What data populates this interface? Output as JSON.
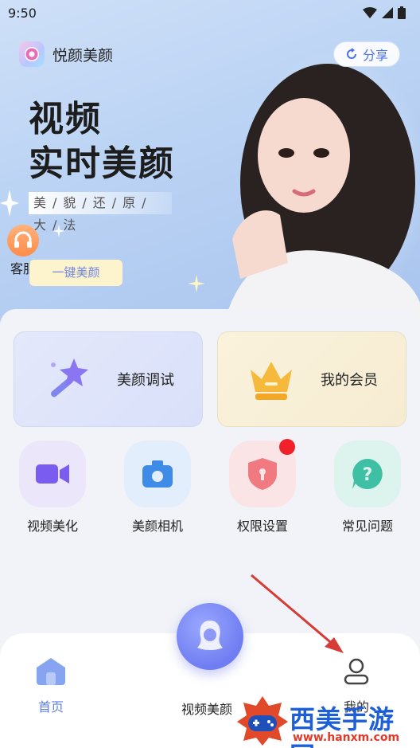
{
  "status_bar": {
    "time": "9:50"
  },
  "app": {
    "name": "悦颜美颜",
    "share_label": "分享"
  },
  "hero": {
    "headline_line1": "视频",
    "headline_line2": "实时美颜",
    "tagline": "美/貌/还/原/大/法",
    "customer_service_label": "客服",
    "one_click_label": "一键美颜"
  },
  "feature_cards": [
    {
      "label": "美颜调试",
      "icon": "magic-wand-icon"
    },
    {
      "label": "我的会员",
      "icon": "crown-icon"
    }
  ],
  "tools": [
    {
      "label": "视频美化",
      "icon": "video-camera-icon",
      "color": "#7a5cf0"
    },
    {
      "label": "美颜相机",
      "icon": "camera-icon",
      "color": "#3f8ce8"
    },
    {
      "label": "权限设置",
      "icon": "shield-icon",
      "color": "#f07a7f",
      "has_badge": true
    },
    {
      "label": "常见问题",
      "icon": "question-icon",
      "color": "#3fc0a4"
    }
  ],
  "bottom_nav": {
    "home_label": "首页",
    "center_label": "视频美颜",
    "mine_label": "我的"
  },
  "watermark": {
    "title": "西美手游网",
    "url": "www.hanxm.com"
  },
  "colors": {
    "accent": "#5f80e3",
    "badge": "#f0212b",
    "arrow": "#d63b35"
  }
}
